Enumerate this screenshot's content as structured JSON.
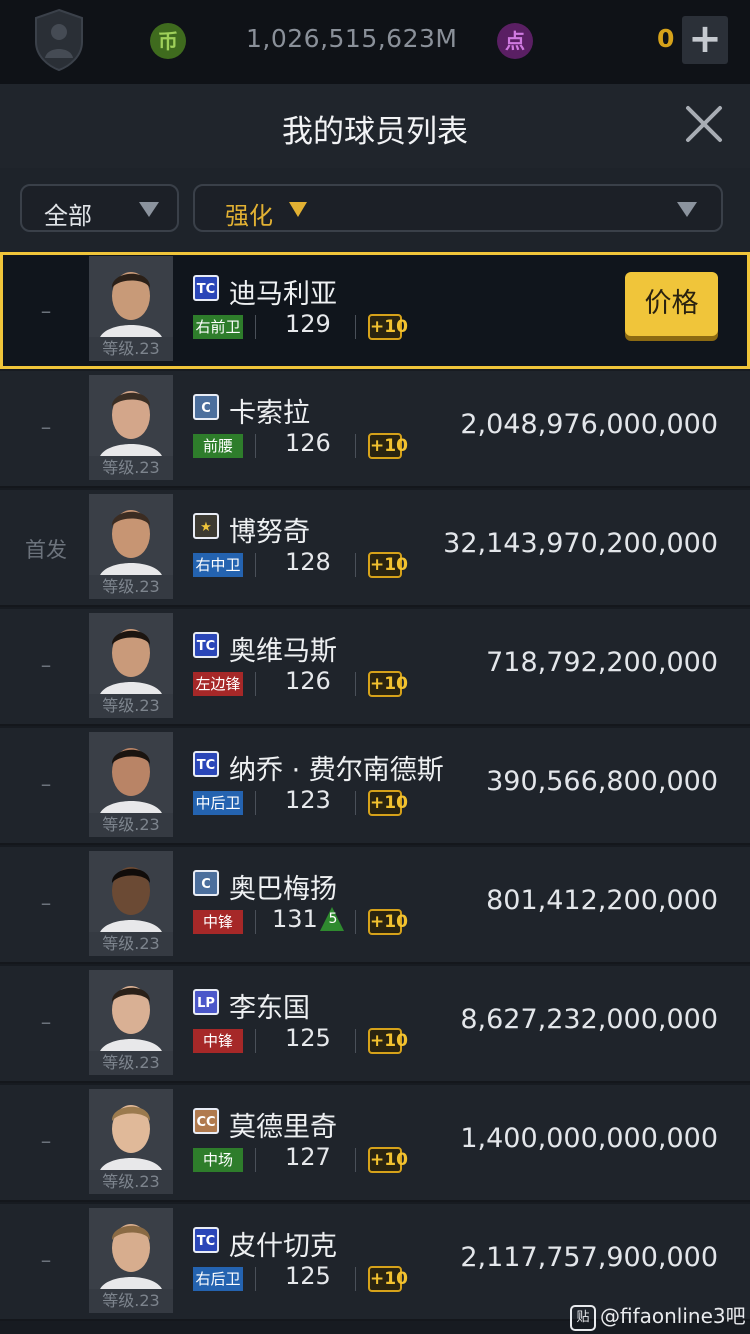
{
  "topbar": {
    "coin_symbol": "币",
    "coins": "1,026,515,623M",
    "point_symbol": "点",
    "points": "0",
    "add_symbol": "+"
  },
  "header": {
    "title": "我的球员列表"
  },
  "filters": {
    "category": "全部",
    "sort": "强化"
  },
  "level_label": "等级.23",
  "boost_label": "+10",
  "price_button": "价格",
  "players": [
    {
      "status": "–",
      "badge": "TC",
      "badge_color": "#2a46b8",
      "name": "迪马利亚",
      "position": "右前卫",
      "pos_color": "#2e7d2b",
      "ovr": "129",
      "boost": "",
      "price": "",
      "selected": true
    },
    {
      "status": "–",
      "badge": "C",
      "badge_color": "#4c6f9d",
      "name": "卡索拉",
      "position": "前腰",
      "pos_color": "#2e7d2b",
      "ovr": "126",
      "boost": "",
      "price": "2,048,976,000,000",
      "selected": false
    },
    {
      "status": "首发",
      "badge": "★",
      "badge_color": "#3c3a32",
      "name": "博努奇",
      "position": "右中卫",
      "pos_color": "#2463b0",
      "ovr": "128",
      "boost": "",
      "price": "32,143,970,200,000",
      "selected": false
    },
    {
      "status": "–",
      "badge": "TC",
      "badge_color": "#2a46b8",
      "name": "奥维马斯",
      "position": "左边锋",
      "pos_color": "#a62828",
      "ovr": "126",
      "boost": "",
      "price": "718,792,200,000",
      "selected": false
    },
    {
      "status": "–",
      "badge": "TC",
      "badge_color": "#2a46b8",
      "name": "纳乔 · 费尔南德斯",
      "position": "中后卫",
      "pos_color": "#2463b0",
      "ovr": "123",
      "boost": "",
      "price": "390,566,800,000",
      "selected": false
    },
    {
      "status": "–",
      "badge": "C",
      "badge_color": "#4c6f9d",
      "name": "奥巴梅扬",
      "position": "中锋",
      "pos_color": "#a62828",
      "ovr": "131",
      "boost": "5",
      "price": "801,412,200,000",
      "selected": false
    },
    {
      "status": "–",
      "badge": "LP",
      "badge_color": "#4b57c9",
      "name": "李东国",
      "position": "中锋",
      "pos_color": "#a62828",
      "ovr": "125",
      "boost": "",
      "price": "8,627,232,000,000",
      "selected": false
    },
    {
      "status": "–",
      "badge": "CC",
      "badge_color": "#b07a4e",
      "name": "莫德里奇",
      "position": "中场",
      "pos_color": "#2e7d2b",
      "ovr": "127",
      "boost": "",
      "price": "1,400,000,000,000",
      "selected": false
    },
    {
      "status": "–",
      "badge": "TC",
      "badge_color": "#2a46b8",
      "name": "皮什切克",
      "position": "右后卫",
      "pos_color": "#2463b0",
      "ovr": "125",
      "boost": "",
      "price": "2,117,757,900,000",
      "selected": false
    }
  ],
  "watermark": {
    "icon": "贴",
    "text": "@fifaonline3吧"
  }
}
